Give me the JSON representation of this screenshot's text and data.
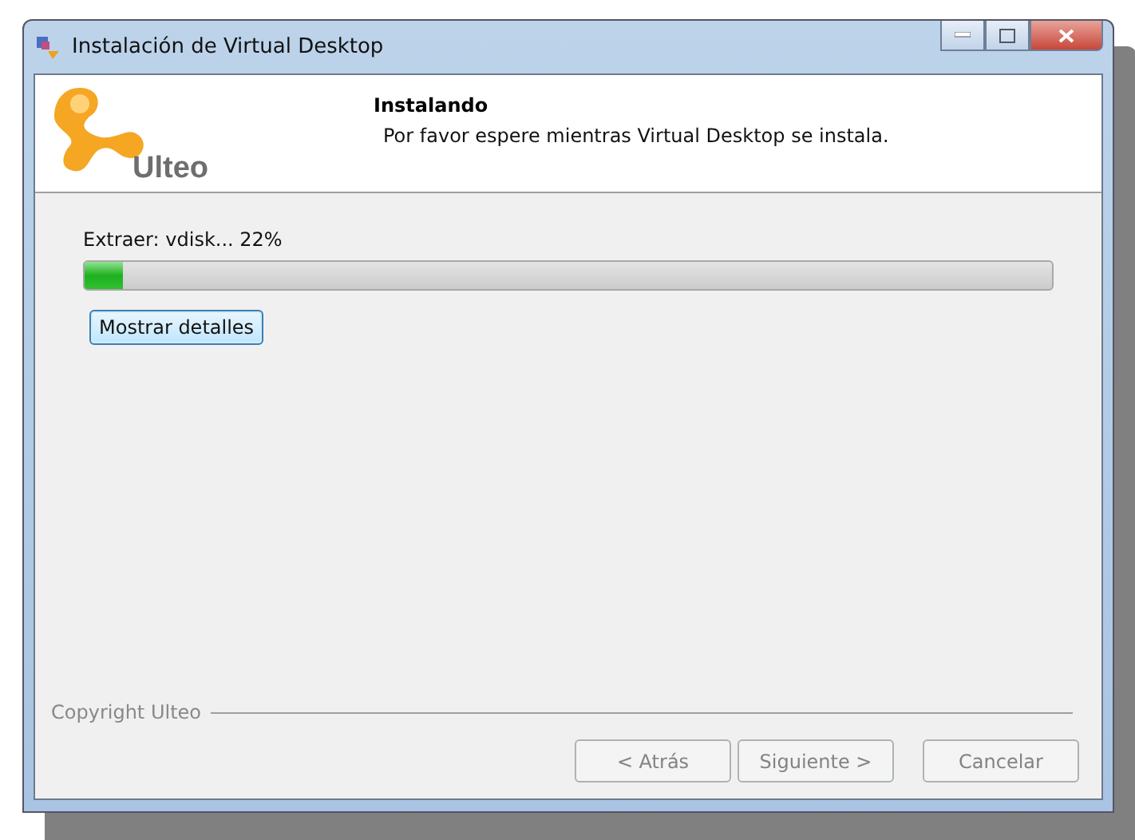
{
  "window": {
    "title": "Instalación de Virtual Desktop"
  },
  "header": {
    "logo_text": "Ulteo",
    "title": "Instalando",
    "subtitle": "Por favor espere mientras Virtual Desktop se instala."
  },
  "progress": {
    "label": "Extraer: vdisk... 22%",
    "level": 0.04
  },
  "details_button": {
    "label": "Mostrar detalles",
    "focused": true
  },
  "footer": {
    "copyright": "Copyright Ulteo"
  },
  "buttons": [
    {
      "label": "< Atrás",
      "disabled": true
    },
    {
      "label": "Siguiente >",
      "disabled": true
    },
    {
      "label": "Cancelar",
      "disabled": true
    }
  ]
}
